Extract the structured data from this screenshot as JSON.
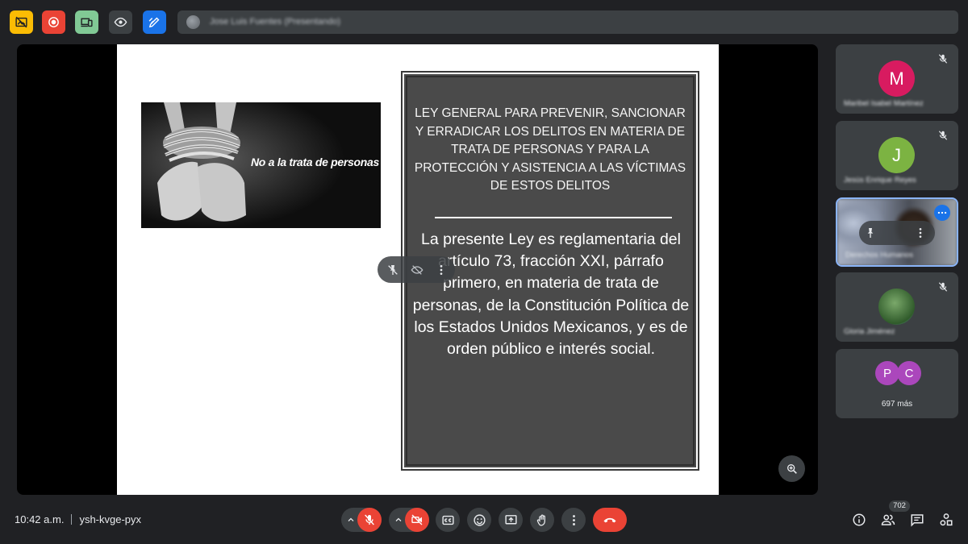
{
  "top_bar": {
    "presenter_label": "Jose Luis Fuentes (Presentando)",
    "buttons": [
      {
        "name": "hide-tiles",
        "icon": "picture-off-icon",
        "color": "#fbbc04",
        "icon_color": "#202124"
      },
      {
        "name": "record",
        "icon": "record-icon",
        "color": "#ea4335",
        "icon_color": "#ffffff"
      },
      {
        "name": "devices",
        "icon": "devices-icon",
        "color": "#81c995",
        "icon_color": "#202124"
      },
      {
        "name": "visibility",
        "icon": "eye-icon",
        "color": "#3c4043",
        "icon_color": "#e8eaed"
      },
      {
        "name": "annotate",
        "icon": "pen-icon",
        "color": "#1a73e8",
        "icon_color": "#ffffff"
      }
    ]
  },
  "slide": {
    "image_caption": "No a la trata de personas",
    "law_title": "LEY GENERAL PARA PREVENIR, SANCIONAR Y ERRADICAR LOS DELITOS EN MATERIA DE TRATA DE PERSONAS Y PARA LA PROTECCIÓN Y ASISTENCIA A LAS VÍCTIMAS DE ESTOS DELITOS",
    "law_body": "La presente Ley es reglamentaria del artículo 73, fracción XXI, párrafo primero, en materia de trata de personas, de la Constitución Política de los Estados Unidos Mexicanos, y es de orden público e interés social."
  },
  "participants": [
    {
      "initial": "M",
      "name": "Maribel Isabel Martínez",
      "avatar_color": "#d81b60",
      "muted": true
    },
    {
      "initial": "J",
      "name": "Jesús Enrique Reyes",
      "avatar_color": "#7cb342",
      "muted": true
    },
    {
      "initial": "",
      "name": "Derechos Humanos",
      "video": true,
      "pinned_controls": true
    },
    {
      "initial": "",
      "name": "Gloria Jiménez",
      "avatar_color": "#4a7a3a",
      "muted": true
    }
  ],
  "more_tile": {
    "avatars": [
      {
        "initial": "P",
        "color": "#ab47bc"
      },
      {
        "initial": "C",
        "color": "#ab47bc"
      }
    ],
    "count_label": "697 más"
  },
  "bottom_bar": {
    "time": "10:42 a.m.",
    "meeting_code": "ysh-kvge-pyx",
    "people_count": "702",
    "end_call_color": "#ea4335"
  }
}
